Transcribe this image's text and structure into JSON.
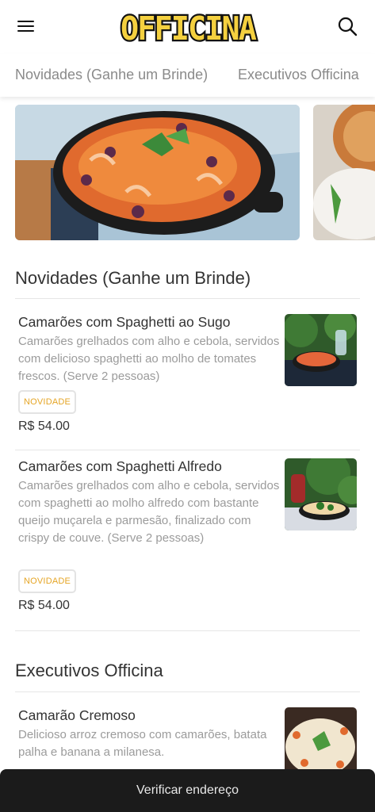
{
  "header": {
    "logo_text": "OFFICINA",
    "logo_color": "#f4d03f"
  },
  "tabs": [
    {
      "label": "Novidades (Ganhe um Brinde)"
    },
    {
      "label": "Executivos Officina"
    }
  ],
  "sections": [
    {
      "title": "Novidades (Ganhe um Brinde)",
      "items": [
        {
          "name": "Camarões com Spaghetti ao Sugo",
          "description": "Camarões grelhados com alho e cebola, servidos com delicioso spaghetti ao molho de tomates frescos. (Serve 2 pessoas)",
          "badge": "NOVIDADE",
          "price": "R$ 54.00"
        },
        {
          "name": "Camarões com Spaghetti Alfredo",
          "description": "Camarões grelhados com alho e cebola, servidos com spaghetti ao molho alfredo com bastante queijo muçarela e parmesão, finalizado com crispy de couve. (Serve 2 pessoas)",
          "badge": "NOVIDADE",
          "price": "R$ 54.00"
        }
      ]
    },
    {
      "title": "Executivos Officina",
      "items": [
        {
          "name": "Camarão Cremoso",
          "description": "Delicioso arroz cremoso com camarões, batata palha e banana a milanesa."
        }
      ]
    }
  ],
  "footer": {
    "button_label": "Verificar endereço"
  },
  "colors": {
    "badge_text": "#e5a525",
    "footer_bg": "#1b1b1b"
  }
}
